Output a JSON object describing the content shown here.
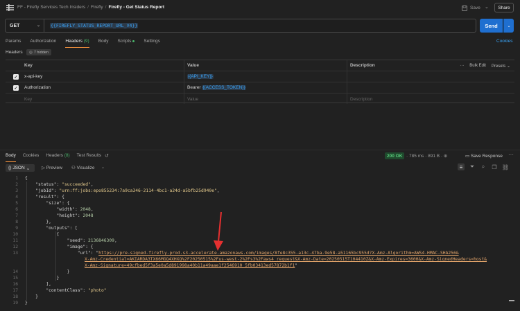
{
  "topbar": {
    "breadcrumb": [
      "FF - Firefly Services Tech Insiders",
      "Firefly"
    ],
    "current": "Firefly - Get Status Report",
    "save_label": "Save",
    "share_label": "Share"
  },
  "request": {
    "method": "GET",
    "url": "{{FIREFLY_STATUS_REPORT_URL_V4}}",
    "send_label": "Send",
    "tabs": [
      {
        "label": "Params"
      },
      {
        "label": "Authorization"
      },
      {
        "label": "Headers",
        "count": "(9)"
      },
      {
        "label": "Body"
      },
      {
        "label": "Scripts"
      },
      {
        "label": "Settings"
      }
    ],
    "cookies_label": "Cookies",
    "headers_sub_label": "Headers",
    "hidden_label": "7 hidden"
  },
  "headers_table": {
    "columns": {
      "key": "Key",
      "value": "Value",
      "description": "Description"
    },
    "bulk_edit": "Bulk Edit",
    "presets": "Presets",
    "rows": [
      {
        "key": "x-api-key",
        "value_prefix": "",
        "value_var": "{{API_KEY}}"
      },
      {
        "key": "Authorization",
        "value_prefix": "Bearer ",
        "value_var": "{{ACCESS_TOKEN}}"
      }
    ],
    "placeholder_key": "Key",
    "placeholder_value": "Value",
    "placeholder_desc": "Description"
  },
  "response": {
    "tabs": [
      {
        "label": "Body"
      },
      {
        "label": "Cookies"
      },
      {
        "label": "Headers",
        "count": "(8)"
      },
      {
        "label": "Test Results"
      }
    ],
    "status": "200 OK",
    "time": "785 ms",
    "size": "891 B",
    "save_response": "Save Response",
    "format": "JSON",
    "preview": "Preview",
    "visualize": "Visualize"
  },
  "code": {
    "status_val": "\"succeeded\"",
    "jobid_val": "\"urn:ff:jobs:epo855234:7a9ca346-2114-4bc1-a24d-a5bfb25d940e\"",
    "width_val": "2048",
    "height_val": "2048",
    "seed_val": "2136846309",
    "url_line1": "https://pre-signed-firefly-prod.s3-accelerate.amazonaws.com/images/8fe8c355-a13c-47ba-9e58-a51165bc955d?X-Amz-Algorithm=AWS4-HMAC-SHA256&",
    "url_line2": "X-Amz-Credential=AKIARDA3TX66MGQ4XHXQ%2F20250515%2Fus-west-2%2Fs3%2Faws4_request&X-Amz-Date=20250515T104410Z&X-Amz-Expires=3600&X-Amz-SignedHeaders=host&",
    "url_line3": "X-Amz-Signature=49cfbed5f3a5e0a5d891998a40b11a49aae1f2546910 5fb03413ed57872b1f1",
    "content_class_val": "\"photo\""
  }
}
